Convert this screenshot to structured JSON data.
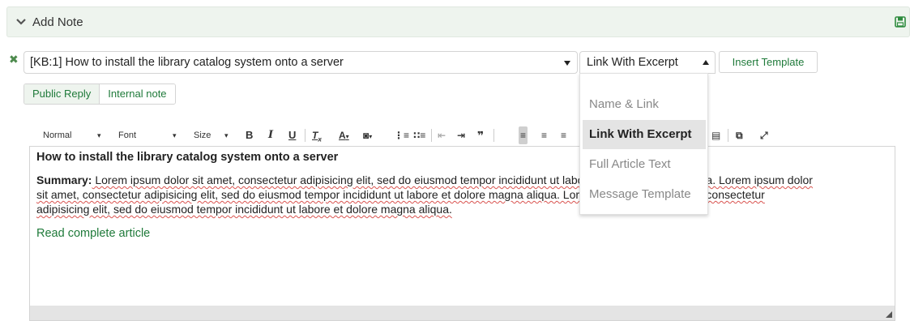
{
  "panel": {
    "title": "Add Note",
    "toggle_icon": "chevron-down-icon",
    "save_icon": "floppy-disk-icon",
    "accent_color": "#1f7a3a"
  },
  "article_select": {
    "value": "[KB:1] How to install the library catalog system onto a server"
  },
  "excerpt_mode": {
    "value": "Link With Excerpt",
    "options": [
      "Name & Link",
      "Link With Excerpt",
      "Full Article Text",
      "Message Template"
    ],
    "selected": "Link With Excerpt"
  },
  "insert_template_label": "Insert Template",
  "reply_tabs": [
    {
      "label": "Public Reply",
      "active": true
    },
    {
      "label": "Internal note",
      "active": false
    }
  ],
  "toolbar": {
    "format": "Normal",
    "font": "Font",
    "size": "Size",
    "bold": "B",
    "italic": "I",
    "underline": "U"
  },
  "editor": {
    "heading": "How to install the library catalog system onto a server",
    "summary_label": "Summary:",
    "summary_line1": " Lorem ipsum dolor sit amet, consectetur adipisicing elit, sed do eiusmod tempor incididunt ut labore et dolore magna aliqua. Lorem ipsum dolor",
    "summary_line2": "sit amet, consectetur adipisicing elit, sed do eiusmod tempor incididunt ut labore et dolore magna aliqua. Lorem ipsum dolor sit amet, consectetur",
    "summary_line3": "adipisicing elit, sed do eiusmod tempor incididunt ut labore et dolore magna aliqua.",
    "read_more": "Read complete article"
  }
}
